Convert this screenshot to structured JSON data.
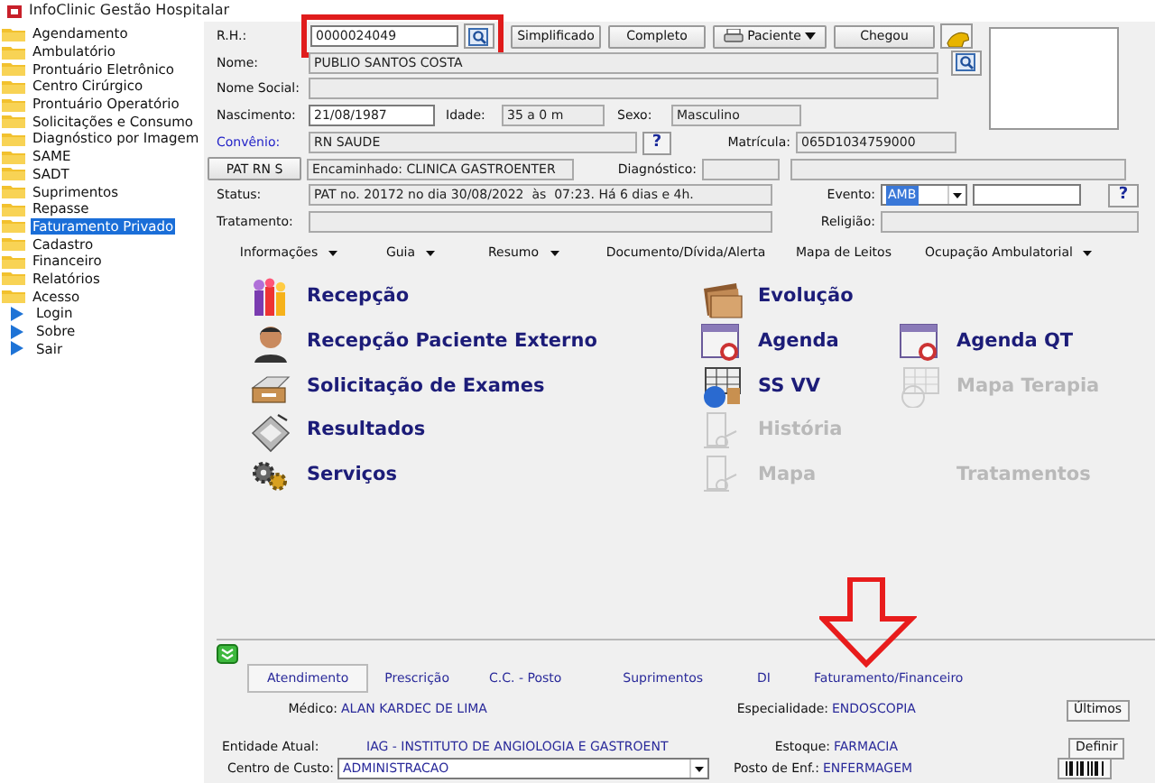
{
  "window": {
    "title": "InfoClinic Gestão Hospitalar"
  },
  "sidebar": {
    "items": [
      {
        "label": "Agendamento",
        "kind": "folder",
        "selected": false
      },
      {
        "label": "Ambulatório",
        "kind": "folder",
        "selected": false
      },
      {
        "label": "Prontuário Eletrônico",
        "kind": "folder",
        "selected": false
      },
      {
        "label": "Centro Cirúrgico",
        "kind": "folder",
        "selected": false
      },
      {
        "label": "Prontuário Operatório",
        "kind": "folder",
        "selected": false
      },
      {
        "label": "Solicitações e Consumo",
        "kind": "folder",
        "selected": false
      },
      {
        "label": "Diagnóstico por Imagem",
        "kind": "folder",
        "selected": false
      },
      {
        "label": "SAME",
        "kind": "folder",
        "selected": false
      },
      {
        "label": "SADT",
        "kind": "folder",
        "selected": false
      },
      {
        "label": "Suprimentos",
        "kind": "folder",
        "selected": false
      },
      {
        "label": "Repasse",
        "kind": "folder",
        "selected": false
      },
      {
        "label": "Faturamento Privado",
        "kind": "folder",
        "selected": true
      },
      {
        "label": "Cadastro",
        "kind": "folder",
        "selected": false
      },
      {
        "label": "Financeiro",
        "kind": "folder",
        "selected": false
      },
      {
        "label": "Relatórios",
        "kind": "folder",
        "selected": false
      },
      {
        "label": "Acesso",
        "kind": "folder",
        "selected": false
      },
      {
        "label": "Login",
        "kind": "action",
        "selected": false
      },
      {
        "label": "Sobre",
        "kind": "action",
        "selected": false
      },
      {
        "label": "Sair",
        "kind": "action",
        "selected": false
      }
    ]
  },
  "form_rows": [
    {
      "items": [
        {
          "kind": "label",
          "text": "R.H.:"
        },
        {
          "kind": "group",
          "highlighted": true,
          "items": [
            {
              "kind": "field",
              "text": "0000024049",
              "readonly": false
            },
            {
              "kind": "iconbutton"
            }
          ]
        },
        {
          "kind": "button",
          "text": "Simplificado"
        },
        {
          "kind": "button",
          "text": "Completo"
        },
        {
          "kind": "menubutton",
          "text": "Paciente"
        },
        {
          "kind": "button",
          "text": "Chegou"
        },
        {
          "kind": "iconbutton"
        }
      ]
    },
    {
      "items": [
        {
          "kind": "label",
          "text": "Nome:"
        },
        {
          "kind": "field",
          "text": "PUBLIO SANTOS COSTA",
          "readonly": true
        },
        {
          "kind": "iconbutton"
        }
      ]
    },
    {
      "items": [
        {
          "kind": "label",
          "text": "Nome Social:"
        },
        {
          "kind": "field",
          "readonly": true
        }
      ]
    },
    {
      "items": [
        {
          "kind": "label",
          "text": "Nascimento:"
        },
        {
          "kind": "field",
          "text": "21/08/1987",
          "readonly": false
        },
        {
          "kind": "label",
          "text": "Idade:"
        },
        {
          "kind": "field",
          "text": "35 a 0 m",
          "readonly": true
        },
        {
          "kind": "label",
          "text": "Sexo:"
        },
        {
          "kind": "field",
          "text": "Masculino",
          "readonly": true
        }
      ]
    },
    {
      "items": [
        {
          "kind": "link",
          "text": "Convênio:"
        },
        {
          "kind": "field",
          "text": "RN SAUDE",
          "readonly": true
        },
        {
          "kind": "help",
          "text": "?"
        },
        {
          "kind": "label",
          "text": "Matrícula:"
        },
        {
          "kind": "field",
          "text": "065D1034759000",
          "readonly": true
        }
      ]
    },
    {
      "items": [
        {
          "kind": "button",
          "text": "PAT RN S"
        },
        {
          "kind": "field",
          "text": "Encaminhado: CLINICA GASTROENTER",
          "readonly": true
        },
        {
          "kind": "label",
          "text": "Diagnóstico:"
        },
        {
          "kind": "field",
          "readonly": true
        },
        {
          "kind": "field",
          "readonly": true
        }
      ]
    },
    {
      "items": [
        {
          "kind": "label",
          "text": "Status:"
        },
        {
          "kind": "field",
          "text": "PAT no. 20172 no dia 30/08/2022  às  07:23. Há 6 dias e 4h.",
          "readonly": true
        },
        {
          "kind": "label",
          "text": "Evento:"
        },
        {
          "kind": "select",
          "text": "AMB",
          "highlighted": true
        },
        {
          "kind": "field",
          "readonly": false
        },
        {
          "kind": "help",
          "text": "?"
        }
      ]
    },
    {
      "items": [
        {
          "kind": "label",
          "text": "Tratamento:"
        },
        {
          "kind": "field",
          "readonly": true
        },
        {
          "kind": "label",
          "text": "Religião:"
        },
        {
          "kind": "field",
          "readonly": true
        }
      ]
    }
  ],
  "menu_tabs": [
    {
      "label": "Informações",
      "dropdown": true
    },
    {
      "label": "Guia",
      "dropdown": true
    },
    {
      "label": "Resumo",
      "dropdown": true
    },
    {
      "label": "Documento/Dívida/Alerta",
      "dropdown": false
    },
    {
      "label": "Mapa de Leitos",
      "dropdown": false
    },
    {
      "label": "Ocupação Ambulatorial",
      "dropdown": true
    }
  ],
  "modules": [
    {
      "items": [
        {
          "label": "Recepção",
          "disabled": false
        },
        {
          "label": "Evolução",
          "disabled": false
        }
      ]
    },
    {
      "items": [
        {
          "label": "Recepção Paciente Externo",
          "disabled": false
        },
        {
          "label": "Agenda",
          "disabled": false
        },
        {
          "label": "Agenda QT",
          "disabled": false
        }
      ]
    },
    {
      "items": [
        {
          "label": "Solicitação de Exames",
          "disabled": false
        },
        {
          "label": "SS VV",
          "disabled": false
        },
        {
          "label": "Mapa Terapia",
          "disabled": true
        }
      ]
    },
    {
      "items": [
        {
          "label": "Resultados",
          "disabled": false
        },
        {
          "label": "História",
          "disabled": true
        }
      ]
    },
    {
      "items": [
        {
          "label": "Serviços",
          "disabled": false
        },
        {
          "label": "Mapa",
          "disabled": true
        },
        {
          "label": "Tratamentos",
          "disabled": true
        }
      ]
    }
  ],
  "bottom_panel": {
    "tabs": [
      {
        "label": "Atendimento",
        "selected": true
      },
      {
        "label": "Prescrição",
        "selected": false
      },
      {
        "label": "C.C. - Posto",
        "selected": false
      },
      {
        "label": "Suprimentos",
        "selected": false
      },
      {
        "label": "DI",
        "selected": false
      },
      {
        "label": "Faturamento/Financeiro",
        "selected": false
      }
    ],
    "medico": {
      "label": "Médico:",
      "value": "ALAN KARDEC DE LIMA"
    },
    "especialidade": {
      "label": "Especialidade:",
      "value": "ENDOSCOPIA"
    },
    "ultimos_button": "Últimos",
    "entidade": {
      "label": "Entidade Atual:",
      "value": "IAG - INSTITUTO DE ANGIOLOGIA E GASTROENT"
    },
    "estoque": {
      "label": "Estoque:",
      "value": "FARMACIA"
    },
    "definir_button": "Definir",
    "centro_custo": {
      "label": "Centro de Custo:",
      "value": "ADMINISTRACAO"
    },
    "posto": {
      "label": "Posto de Enf.:",
      "value": "ENFERMAGEM"
    }
  },
  "annotations": [
    {
      "kind": "arrow"
    }
  ]
}
